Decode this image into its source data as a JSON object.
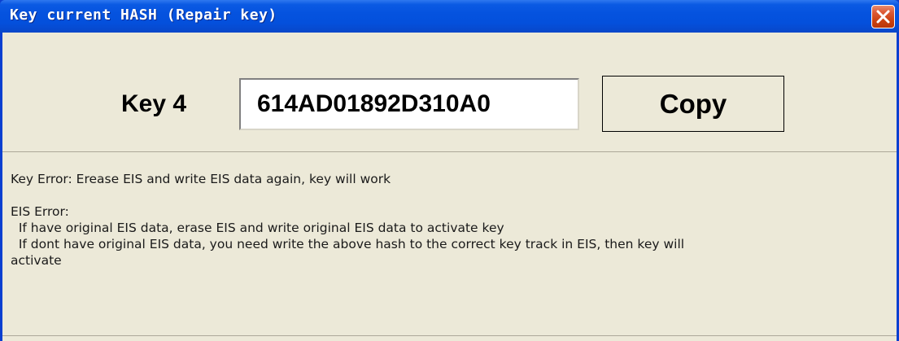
{
  "window": {
    "title": "Key current HASH (Repair key)",
    "close_icon": "close-icon",
    "titlebar_color": "#0553df",
    "close_color": "#d8491f",
    "body_color": "#ece9d8"
  },
  "key_panel": {
    "label": "Key 4",
    "hash_value": "614AD01892D310A0",
    "copy_label": "Copy"
  },
  "messages": {
    "key_error": "Key Error: Erease EIS and write EIS data again, key will work",
    "eis_error_title": "EIS Error:",
    "eis_line1": "  If have original EIS data, erase EIS and write original EIS data to activate key",
    "eis_line2": "  If dont have original EIS data, you need write the above hash to the correct key track in EIS, then key will",
    "eis_line3": "activate"
  }
}
